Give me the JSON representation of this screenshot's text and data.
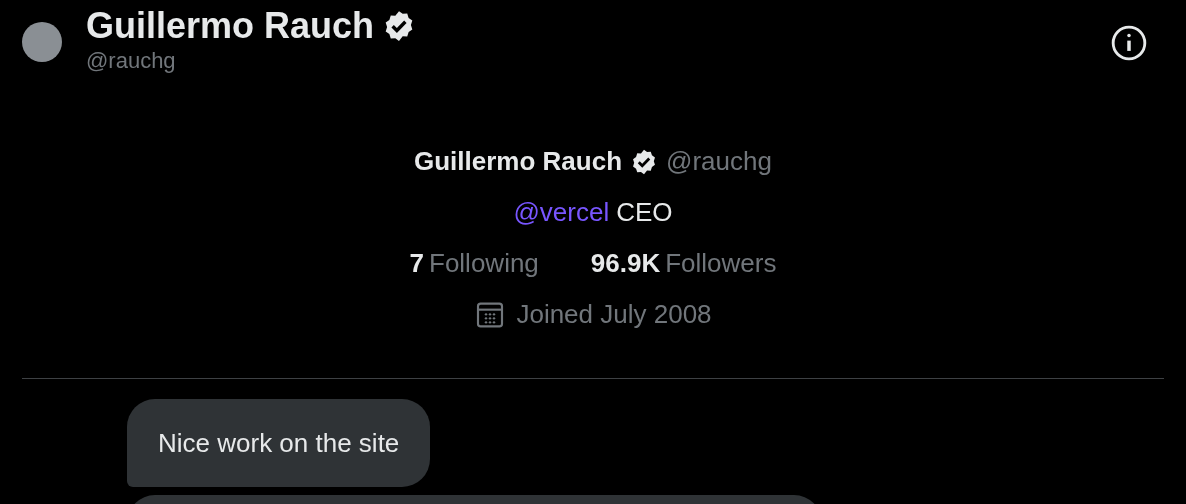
{
  "header": {
    "name": "Guillermo Rauch",
    "handle": "@rauchg",
    "verified": true
  },
  "profile": {
    "name": "Guillermo Rauch",
    "verified": true,
    "handle": "@rauchg",
    "bio": {
      "mention": "@vercel",
      "text": "CEO"
    },
    "stats": [
      {
        "value": "7",
        "label": "Following"
      },
      {
        "value": "96.9K",
        "label": "Followers"
      }
    ],
    "joined": "Joined July 2008"
  },
  "messages": [
    {
      "kind": "received",
      "text": "Nice work on the site"
    },
    {
      "kind": "received"
    }
  ]
}
